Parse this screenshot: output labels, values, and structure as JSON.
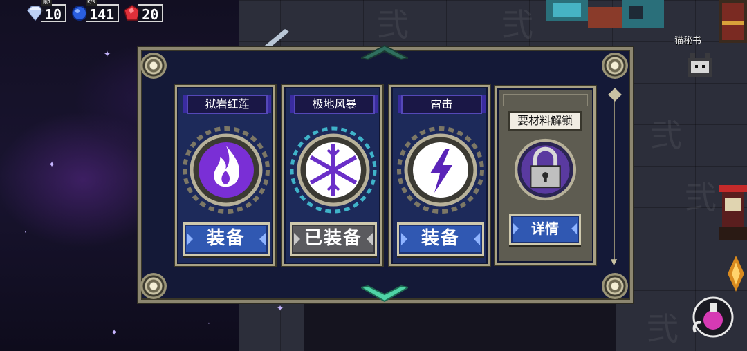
{
  "currency": {
    "gems": {
      "value": "10",
      "sub_label": "限7",
      "icon": "diamond-icon",
      "color": "#d8e6ff"
    },
    "energy": {
      "value": "141",
      "sub_label": "K/S",
      "icon": "blue-orb-icon",
      "color": "#2a5fe0"
    },
    "rubies": {
      "value": "20",
      "icon": "red-gem-icon",
      "color": "#e0303a"
    }
  },
  "npc": {
    "label": "猫秘书"
  },
  "skills": [
    {
      "title": "狱岩红莲",
      "icon": "flame-icon",
      "button_label": "装备",
      "state": "available"
    },
    {
      "title": "极地风暴",
      "icon": "snowflake-icon",
      "button_label": "已装备",
      "state": "equipped"
    },
    {
      "title": "雷击",
      "icon": "lightning-icon",
      "button_label": "装备",
      "state": "available"
    },
    {
      "title": "要材料解锁",
      "icon": "lock-icon",
      "button_label": "详情",
      "state": "locked"
    }
  ],
  "colors": {
    "panel_bg": "#141937",
    "frame": "#8c8670",
    "button_blue": "#3058b2",
    "emblem_purple": "#7a2fd6",
    "scroll_chevron": "#4fd3a6"
  }
}
